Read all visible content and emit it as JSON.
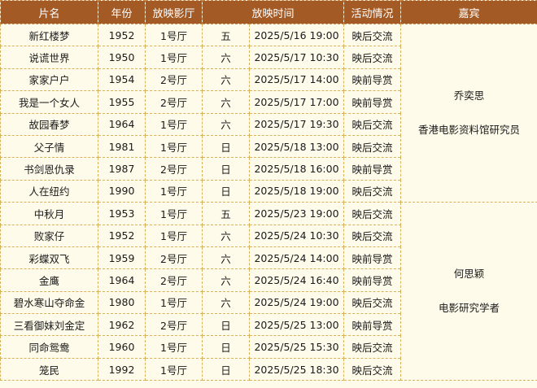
{
  "headers": [
    "片名",
    "年份",
    "放映影厅",
    "放映时间",
    "活动情况",
    "嘉宾"
  ],
  "rows": [
    {
      "film": "新红楼梦",
      "year": "1952",
      "hall": "1号厅",
      "day": "五",
      "time": "2025/5/16 19:00",
      "activity": "映后交流"
    },
    {
      "film": "说谎世界",
      "year": "1950",
      "hall": "1号厅",
      "day": "六",
      "time": "2025/5/17 10:30",
      "activity": "映后交流"
    },
    {
      "film": "家家户户",
      "year": "1954",
      "hall": "2号厅",
      "day": "六",
      "time": "2025/5/17 14:00",
      "activity": "映前导赏"
    },
    {
      "film": "我是一个女人",
      "year": "1955",
      "hall": "2号厅",
      "day": "六",
      "time": "2025/5/17 17:00",
      "activity": "映前导赏"
    },
    {
      "film": "故园春梦",
      "year": "1964",
      "hall": "1号厅",
      "day": "六",
      "time": "2025/5/17 19:30",
      "activity": "映后交流"
    },
    {
      "film": "父子情",
      "year": "1981",
      "hall": "1号厅",
      "day": "日",
      "time": "2025/5/18 13:00",
      "activity": "映后交流"
    },
    {
      "film": "书剑恩仇录",
      "year": "1987",
      "hall": "2号厅",
      "day": "日",
      "time": "2025/5/18 16:00",
      "activity": "映前导赏"
    },
    {
      "film": "人在纽约",
      "year": "1990",
      "hall": "1号厅",
      "day": "日",
      "time": "2025/5/18 19:00",
      "activity": "映后交流"
    },
    {
      "film": "中秋月",
      "year": "1953",
      "hall": "1号厅",
      "day": "五",
      "time": "2025/5/23 19:00",
      "activity": "映后交流"
    },
    {
      "film": "败家仔",
      "year": "1952",
      "hall": "1号厅",
      "day": "六",
      "time": "2025/5/24 10:30",
      "activity": "映后交流"
    },
    {
      "film": "彩蝶双飞",
      "year": "1959",
      "hall": "2号厅",
      "day": "六",
      "time": "2025/5/24 14:00",
      "activity": "映前导赏"
    },
    {
      "film": "金鹰",
      "year": "1964",
      "hall": "2号厅",
      "day": "六",
      "time": "2025/5/24 16:40",
      "activity": "映前导赏"
    },
    {
      "film": "碧水寒山夺命金",
      "year": "1980",
      "hall": "1号厅",
      "day": "六",
      "time": "2025/5/24 19:00",
      "activity": "映后交流"
    },
    {
      "film": "三看御妹刘金定",
      "year": "1962",
      "hall": "2号厅",
      "day": "日",
      "time": "2025/5/25 13:00",
      "activity": "映前导赏"
    },
    {
      "film": "同命鸳鸯",
      "year": "1960",
      "hall": "1号厅",
      "day": "日",
      "time": "2025/5/25 15:30",
      "activity": "映后交流"
    },
    {
      "film": "笼民",
      "year": "1992",
      "hall": "1号厅",
      "day": "日",
      "time": "2025/5/25 18:30",
      "activity": "映后交流"
    }
  ],
  "guests": [
    {
      "name": "乔奕思",
      "title": "香港电影资料馆研究员"
    },
    {
      "name": "何思颖",
      "title": "电影研究学者"
    }
  ]
}
